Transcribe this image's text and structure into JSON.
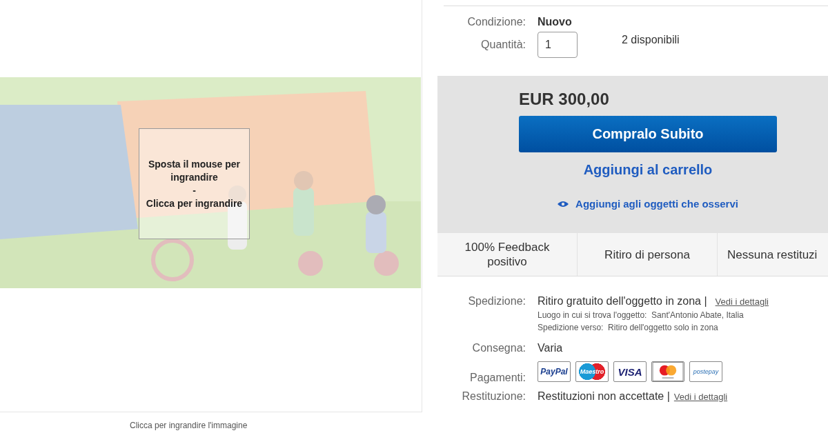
{
  "image_viewer": {
    "hover_hint": [
      "Sposta il mouse per ingrandire",
      "-",
      "Clicca per ingrandire"
    ],
    "caption": "Clicca per ingrandire l'immagine"
  },
  "condition": {
    "label": "Condizione:",
    "value": "Nuovo"
  },
  "quantity": {
    "label": "Quantità:",
    "value": "1",
    "available": "2 disponibili"
  },
  "purchase": {
    "price": "EUR 300,00",
    "buy_now": "Compralo Subito",
    "add_to_cart": "Aggiungi al carrello",
    "watch": "Aggiungi agli oggetti che osservi"
  },
  "highlights": [
    "100% Feedback positivo",
    "Ritiro di persona",
    "Nessuna restituzi"
  ],
  "shipping": {
    "label": "Spedizione:",
    "value": "Ritiro gratuito dell'oggetto in zona |",
    "link": "Vedi i dettagli",
    "details": [
      {
        "label": "Luogo in cui si trova l'oggetto:",
        "value": "Sant'Antonio Abate, Italia"
      },
      {
        "label": "Spedizione verso:",
        "value": "Ritiro dell'oggetto solo in zona"
      }
    ]
  },
  "delivery": {
    "label": "Consegna:",
    "value": "Varia"
  },
  "payments": {
    "label": "Pagamenti:",
    "methods": [
      {
        "kind": "text",
        "text": "PayPal"
      },
      {
        "kind": "maestro",
        "text": "Maestro"
      },
      {
        "kind": "text",
        "text": "VISA"
      },
      {
        "kind": "circles"
      },
      {
        "kind": "small",
        "text": "postepay"
      }
    ]
  },
  "returns": {
    "label": "Restituzione:",
    "value": "Restituzioni non accettate |",
    "link": "Vedi i dettagli"
  }
}
